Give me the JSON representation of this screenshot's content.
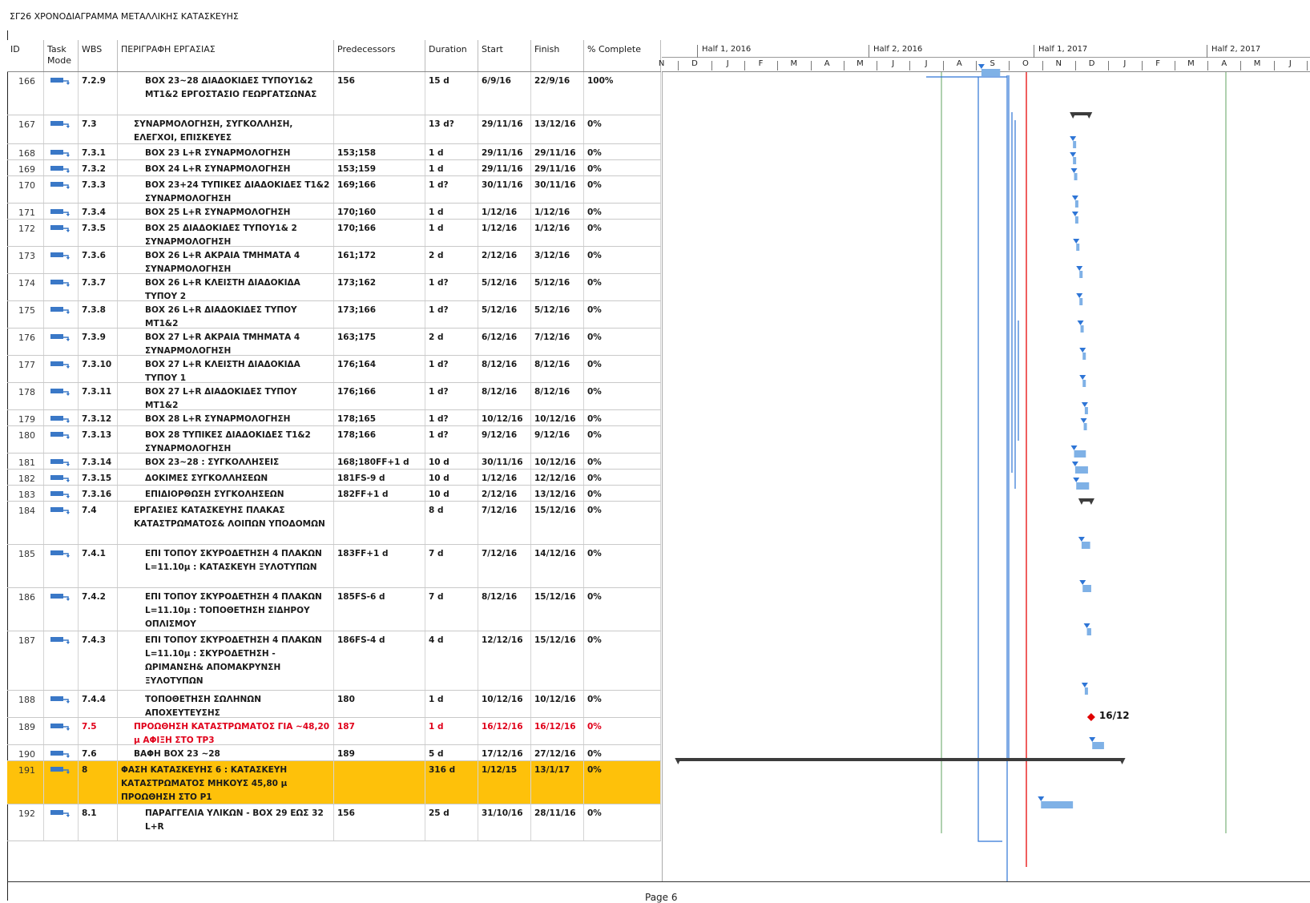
{
  "title": "ΣΓ26 ΧΡΟΝΟΔΙΑΓΡΑΜΜΑ ΜΕΤΑΛΛΙΚΗΣ ΚΑΤΑΣΚΕΥΗΣ",
  "page_label": "Page 6",
  "columns": {
    "id": "ID",
    "mode": "Task Mode",
    "wbs": "WBS",
    "name": "ΠΕΡΙΓΡΑΦΗ ΕΡΓΑΣΙΑΣ",
    "pred": "Predecessors",
    "dur": "Duration",
    "start": "Start",
    "finish": "Finish",
    "pct": "% Complete"
  },
  "timeline": {
    "halves": [
      "Half 1, 2016",
      "Half 2, 2016",
      "Half 1, 2017",
      "Half 2, 2017"
    ],
    "months": [
      "N",
      "D",
      "J",
      "F",
      "M",
      "A",
      "M",
      "J",
      "J",
      "A",
      "S",
      "O",
      "N",
      "D",
      "J",
      "F",
      "M",
      "A",
      "M",
      "J",
      "J",
      "A"
    ]
  },
  "milestone_label": "16/12",
  "colors": {
    "bar": "#7fb1e6",
    "arrow": "#2e75d6",
    "summary": "#3c3c3c",
    "status_line": "#e81919",
    "milestone": "#e00000",
    "highlight": "#fec10a",
    "timescale_line": "#5fa35f"
  },
  "tasks": [
    {
      "id": "166",
      "wbs": "7.2.9",
      "name": "ΒΟΧ 23~28 ΔΙΑΔΟΚΙΔΕΣ ΤΥΠΟΥ1&2 ΜΤ1&2 ΕΡΓΟΣΤΑΣΙΟ ΓΕΩΡΓΑΤΣΩΝΑΣ",
      "pred": "156",
      "dur": "15 d",
      "start": "6/9/16",
      "finish": "22/9/16",
      "pct": "100%"
    },
    {
      "id": "167",
      "wbs": "7.3",
      "name": "ΣΥΝΑΡΜΟΛΟΓΗΣΗ, ΣΥΓΚΟΛΛΗΣΗ, ΕΛΕΓΧΟΙ, ΕΠΙΣΚΕΥΕΣ",
      "pred": "",
      "dur": "13 d?",
      "start": "29/11/16",
      "finish": "13/12/16",
      "pct": "0%"
    },
    {
      "id": "168",
      "wbs": "7.3.1",
      "name": "ΒΟΧ 23 L+R ΣΥΝΑΡΜΟΛΟΓΗΣΗ",
      "pred": "153;158",
      "dur": "1 d",
      "start": "29/11/16",
      "finish": "29/11/16",
      "pct": "0%"
    },
    {
      "id": "169",
      "wbs": "7.3.2",
      "name": "ΒΟΧ 24 L+R ΣΥΝΑΡΜΟΛΟΓΗΣΗ",
      "pred": "153;159",
      "dur": "1 d",
      "start": "29/11/16",
      "finish": "29/11/16",
      "pct": "0%"
    },
    {
      "id": "170",
      "wbs": "7.3.3",
      "name": "ΒΟΧ 23+24 ΤΥΠΙΚΕΣ ΔΙΑΔΟΚΙΔΕΣ Τ1&2 ΣΥΝΑΡΜΟΛΟΓΗΣΗ",
      "pred": "169;166",
      "dur": "1 d?",
      "start": "30/11/16",
      "finish": "30/11/16",
      "pct": "0%"
    },
    {
      "id": "171",
      "wbs": "7.3.4",
      "name": "ΒΟΧ 25 L+R  ΣΥΝΑΡΜΟΛΟΓΗΣΗ",
      "pred": "170;160",
      "dur": "1 d",
      "start": "1/12/16",
      "finish": "1/12/16",
      "pct": "0%"
    },
    {
      "id": "172",
      "wbs": "7.3.5",
      "name": "ΒΟΧ 25 ΔΙΑΔΟΚΙΔΕΣ ΤΥΠΟΥ1& 2 ΣΥΝΑΡΜΟΛΟΓΗΣΗ",
      "pred": "170;166",
      "dur": "1 d",
      "start": "1/12/16",
      "finish": "1/12/16",
      "pct": "0%"
    },
    {
      "id": "173",
      "wbs": "7.3.6",
      "name": "ΒΟΧ 26 L+R ΑΚΡΑΙΑ ΤΜΗΜΑΤΑ 4 ΣΥΝΑΡΜΟΛΟΓΗΣΗ",
      "pred": "161;172",
      "dur": "2 d",
      "start": "2/12/16",
      "finish": "3/12/16",
      "pct": "0%"
    },
    {
      "id": "174",
      "wbs": "7.3.7",
      "name": "ΒΟΧ 26 L+R ΚΛΕΙΣΤΗ ΔΙΑΔΟΚΙΔΑ ΤΥΠΟΥ 2",
      "pred": "173;162",
      "dur": "1 d?",
      "start": "5/12/16",
      "finish": "5/12/16",
      "pct": "0%"
    },
    {
      "id": "175",
      "wbs": "7.3.8",
      "name": "ΒΟΧ 26 L+R ΔΙΑΔΟΚΙΔΕΣ ΤΥΠΟΥ ΜΤ1&2",
      "pred": "173;166",
      "dur": "1 d?",
      "start": "5/12/16",
      "finish": "5/12/16",
      "pct": "0%"
    },
    {
      "id": "176",
      "wbs": "7.3.9",
      "name": "ΒΟΧ 27 L+R ΑΚΡΑΙΑ ΤΜΗΜΑΤΑ 4 ΣΥΝΑΡΜΟΛΟΓΗΣΗ",
      "pred": "163;175",
      "dur": "2 d",
      "start": "6/12/16",
      "finish": "7/12/16",
      "pct": "0%"
    },
    {
      "id": "177",
      "wbs": "7.3.10",
      "name": "ΒΟΧ 27 L+R ΚΛΕΙΣΤΗ ΔΙΑΔΟΚΙΔΑ ΤΥΠΟΥ 1",
      "pred": "176;164",
      "dur": "1 d?",
      "start": "8/12/16",
      "finish": "8/12/16",
      "pct": "0%"
    },
    {
      "id": "178",
      "wbs": "7.3.11",
      "name": "ΒΟΧ 27 L+R ΔΙΑΔΟΚΙΔΕΣ ΤΥΠΟΥ ΜΤ1&2",
      "pred": "176;166",
      "dur": "1 d?",
      "start": "8/12/16",
      "finish": "8/12/16",
      "pct": "0%"
    },
    {
      "id": "179",
      "wbs": "7.3.12",
      "name": "ΒΟΧ 28 L+R  ΣΥΝΑΡΜΟΛΟΓΗΣΗ",
      "pred": "178;165",
      "dur": "1 d?",
      "start": "10/12/16",
      "finish": "10/12/16",
      "pct": "0%"
    },
    {
      "id": "180",
      "wbs": "7.3.13",
      "name": "ΒΟΧ 28 ΤΥΠΙΚΕΣ ΔΙΑΔΟΚΙΔΕΣ Τ1&2 ΣΥΝΑΡΜΟΛΟΓΗΣΗ",
      "pred": "178;166",
      "dur": "1 d?",
      "start": "9/12/16",
      "finish": "9/12/16",
      "pct": "0%"
    },
    {
      "id": "181",
      "wbs": "7.3.14",
      "name": "ΒΟΧ 23~28 : ΣΥΓΚΟΛΛΗΣΕΙΣ",
      "pred": "168;180FF+1 d",
      "dur": "10 d",
      "start": "30/11/16",
      "finish": "10/12/16",
      "pct": "0%"
    },
    {
      "id": "182",
      "wbs": "7.3.15",
      "name": "ΔΟΚΙΜΕΣ ΣΥΓΚΟΛΛΗΣΕΩΝ",
      "pred": "181FS-9 d",
      "dur": "10 d",
      "start": "1/12/16",
      "finish": "12/12/16",
      "pct": "0%"
    },
    {
      "id": "183",
      "wbs": "7.3.16",
      "name": "ΕΠΙΔΙΟΡΘΩΣΗ ΣΥΓΚΟΛΗΣΕΩΝ",
      "pred": "182FF+1 d",
      "dur": "10 d",
      "start": "2/12/16",
      "finish": "13/12/16",
      "pct": "0%"
    },
    {
      "id": "184",
      "wbs": "7.4",
      "name": "ΕΡΓΑΣΙΕΣ ΚΑΤΑΣΚΕΥΗΣ ΠΛΑΚΑΣ ΚΑΤΑΣΤΡΩΜΑΤΟΣ& ΛΟΙΠΩΝ ΥΠΟΔΟΜΩΝ",
      "pred": "",
      "dur": "8 d",
      "start": "7/12/16",
      "finish": "15/12/16",
      "pct": "0%"
    },
    {
      "id": "185",
      "wbs": "7.4.1",
      "name": "ΕΠΙ ΤΟΠΟΥ ΣΚΥΡΟΔΕΤΗΣΗ 4 ΠΛΑΚΩΝ L=11.10μ : ΚΑΤΑΣΚΕΥΗ ΞΥΛΟΤΥΠΩΝ",
      "pred": "183FF+1 d",
      "dur": "7 d",
      "start": "7/12/16",
      "finish": "14/12/16",
      "pct": "0%"
    },
    {
      "id": "186",
      "wbs": "7.4.2",
      "name": "ΕΠΙ ΤΟΠΟΥ ΣΚΥΡΟΔΕΤΗΣΗ 4 ΠΛΑΚΩΝ L=11.10μ : ΤΟΠΟΘΕΤΗΣΗ ΣΙΔΗΡΟΥ ΟΠΛΙΣΜΟΥ",
      "pred": "185FS-6 d",
      "dur": "7 d",
      "start": "8/12/16",
      "finish": "15/12/16",
      "pct": "0%"
    },
    {
      "id": "187",
      "wbs": "7.4.3",
      "name": "ΕΠΙ ΤΟΠΟΥ ΣΚΥΡΟΔΕΤΗΣΗ 4 ΠΛΑΚΩΝ L=11.10μ : ΣΚΥΡΟΔΕΤΗΣΗ - ΩΡΙΜΑΝΣΗ& ΑΠΟΜΑΚΡΥΝΣΗ ΞΥΛΟΤΥΠΩΝ",
      "pred": "186FS-4 d",
      "dur": "4 d",
      "start": "12/12/16",
      "finish": "15/12/16",
      "pct": "0%"
    },
    {
      "id": "188",
      "wbs": "7.4.4",
      "name": "ΤΟΠΟΘΕΤΗΣΗ ΣΩΛΗΝΩΝ ΑΠΟΧΕΥΤΕΥΣΗΣ",
      "pred": "180",
      "dur": "1 d",
      "start": "10/12/16",
      "finish": "10/12/16",
      "pct": "0%"
    },
    {
      "id": "189",
      "wbs": "7.5",
      "name": "ΠΡΟΩΘΗΣΗ ΚΑΤΑΣΤΡΩΜΑΤΟΣ ΓΙΑ ~48,20 μ ΑΦΙΞΗ ΣΤΟ ΤΡ3",
      "pred": "187",
      "dur": "1 d",
      "start": "16/12/16",
      "finish": "16/12/16",
      "pct": "0%"
    },
    {
      "id": "190",
      "wbs": "7.6",
      "name": "ΒΑΦΗ ΒΟΧ 23 ~28",
      "pred": "189",
      "dur": "5 d",
      "start": "17/12/16",
      "finish": "27/12/16",
      "pct": "0%"
    },
    {
      "id": "191",
      "wbs": "8",
      "name": "ΦΑΣΗ ΚΑΤΑΣΚΕΥΗΣ 6 : ΚΑΤΑΣΚΕΥΗ ΚΑΤΑΣΤΡΩΜΑΤΟΣ ΜΗΚΟΥΣ 45,80 μ ΠΡΟΩΘΗΣΗ ΣΤΟ Ρ1",
      "pred": "",
      "dur": "316 d",
      "start": "1/12/15",
      "finish": "13/1/17",
      "pct": "0%"
    },
    {
      "id": "192",
      "wbs": "8.1",
      "name": "ΠΑΡΑΓΓΕΛΙΑ ΥΛΙΚΩΝ - ΒΟΧ 29 ΕΩΣ 32 L+R",
      "pred": "156",
      "dur": "25 d",
      "start": "31/10/16",
      "finish": "28/11/16",
      "pct": "0%"
    }
  ]
}
